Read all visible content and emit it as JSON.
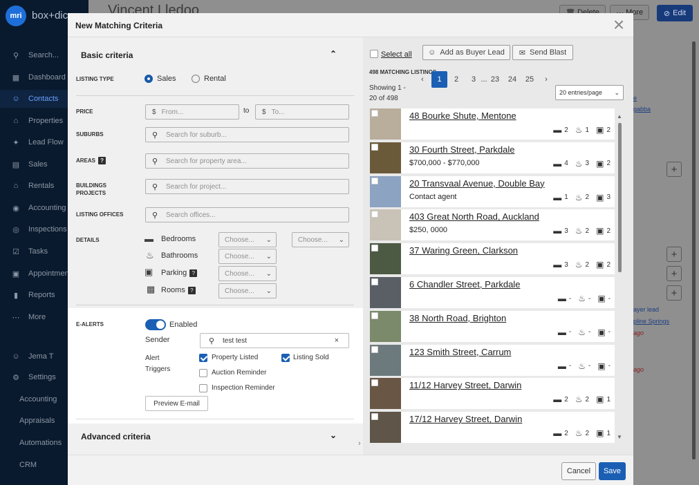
{
  "app": {
    "brand": "box+dice",
    "logo_text": "mri",
    "page_title": "Vincent Lledoo"
  },
  "sidebar": {
    "search_label": "Search...",
    "items": [
      {
        "label": "Dashboard",
        "icon": "grid-icon"
      },
      {
        "label": "Contacts",
        "icon": "person-icon"
      },
      {
        "label": "Properties",
        "icon": "home-icon"
      },
      {
        "label": "Lead Flow",
        "icon": "flow-icon"
      },
      {
        "label": "Sales",
        "icon": "sign-icon"
      },
      {
        "label": "Rentals",
        "icon": "house-key-icon"
      },
      {
        "label": "Accounting",
        "icon": "dollar-icon"
      },
      {
        "label": "Inspections",
        "icon": "eye-icon"
      },
      {
        "label": "Tasks",
        "icon": "checklist-icon"
      },
      {
        "label": "Appointments",
        "icon": "calendar-icon"
      },
      {
        "label": "Reports",
        "icon": "bar-chart-icon"
      },
      {
        "label": "More",
        "icon": "ellipsis-icon"
      }
    ],
    "user": "Jema T",
    "settings": "Settings",
    "sub_items": [
      "Accounting",
      "Appraisals",
      "Automations",
      "CRM"
    ]
  },
  "background": {
    "delete": "Delete",
    "more": "More",
    "edit": "Edit",
    "side_text_1": "ayer lead",
    "side_text_2": "pline Springs",
    "side_text_3": "ago",
    "side_text_4": "gabba",
    "side_text_5": "e",
    "side_text_6": "ago"
  },
  "modal": {
    "title": "New Matching Criteria",
    "basic_criteria": "Basic criteria",
    "advanced_criteria": "Advanced criteria",
    "labels": {
      "listing_type": "LISTING TYPE",
      "price": "PRICE",
      "suburbs": "SUBURBS",
      "areas": "AREAS",
      "buildings": "BUILDINGS PROJECTS",
      "listing_offices": "LISTING OFFICES",
      "details": "DETAILS",
      "e_alerts": "E-ALERTS"
    },
    "listing_type": {
      "sales": "Sales",
      "rental": "Rental",
      "selected": "Sales"
    },
    "price": {
      "from_placeholder": "From...",
      "to_label": "to",
      "to_placeholder": "To...",
      "currency": "$"
    },
    "placeholders": {
      "suburbs": "Search for suburb...",
      "areas": "Search for property area...",
      "buildings": "Search for project...",
      "offices": "Search offices..."
    },
    "details": {
      "bedrooms": "Bedrooms",
      "bathrooms": "Bathrooms",
      "parking": "Parking",
      "rooms": "Rooms",
      "choose": "Choose..."
    },
    "e_alerts": {
      "enabled": "Enabled",
      "sender_label": "Sender",
      "sender_value": "test test",
      "alert_triggers": "Alert Triggers",
      "property_listed": "Property Listed",
      "listing_sold": "Listing Sold",
      "auction_reminder": "Auction Reminder",
      "inspection_reminder": "Inspection Reminder",
      "preview": "Preview E-mail"
    },
    "right": {
      "select_all": "Select all",
      "add_buyer_lead": "Add as Buyer Lead",
      "send_blast": "Send Blast",
      "matching": "498 MATCHING LISTINGS",
      "showing_1": "Showing 1 -",
      "showing_2": "20 of 498",
      "pages": [
        "1",
        "2",
        "3",
        "...",
        "23",
        "24",
        "25"
      ],
      "entries": "20 entries/page"
    },
    "listings": [
      {
        "address": "48 Bourke Shute, Mentone",
        "price": "",
        "beds": "2",
        "baths": "1",
        "cars": "2",
        "thumb": "#b9ad9c"
      },
      {
        "address": "30 Fourth Street, Parkdale",
        "price": "$700,000 - $770,000",
        "beds": "4",
        "baths": "3",
        "cars": "2",
        "thumb": "#6b5a3a"
      },
      {
        "address": "20 Transvaal Avenue, Double Bay",
        "price": "Contact agent",
        "beds": "1",
        "baths": "2",
        "cars": "3",
        "thumb": "#8ca3c2"
      },
      {
        "address": "403 Great North Road, Auckland",
        "price": "$250, 0000",
        "beds": "3",
        "baths": "2",
        "cars": "2",
        "thumb": "#c9c2b6"
      },
      {
        "address": "37 Waring Green, Clarkson",
        "price": "",
        "beds": "3",
        "baths": "2",
        "cars": "2",
        "thumb": "#4c5a44"
      },
      {
        "address": "6 Chandler Street, Parkdale",
        "price": "",
        "beds": "-",
        "baths": "-",
        "cars": "-",
        "thumb": "#5a5f66"
      },
      {
        "address": "38 North Road, Brighton",
        "price": "",
        "beds": "-",
        "baths": "-",
        "cars": "-",
        "thumb": "#7a8a6a"
      },
      {
        "address": "123 Smith Street, Carrum",
        "price": "",
        "beds": "-",
        "baths": "-",
        "cars": "-",
        "thumb": "#6d7a7d"
      },
      {
        "address": "11/12 Harvey Street, Darwin",
        "price": "",
        "beds": "2",
        "baths": "2",
        "cars": "1",
        "thumb": "#6a5644"
      },
      {
        "address": "17/12 Harvey Street, Darwin",
        "price": "",
        "beds": "2",
        "baths": "2",
        "cars": "1",
        "thumb": "#5f5548"
      }
    ],
    "footer": {
      "cancel": "Cancel",
      "save": "Save"
    }
  },
  "colors": {
    "accent": "#1a5fb4",
    "sidebar": "#0a1a2e"
  }
}
